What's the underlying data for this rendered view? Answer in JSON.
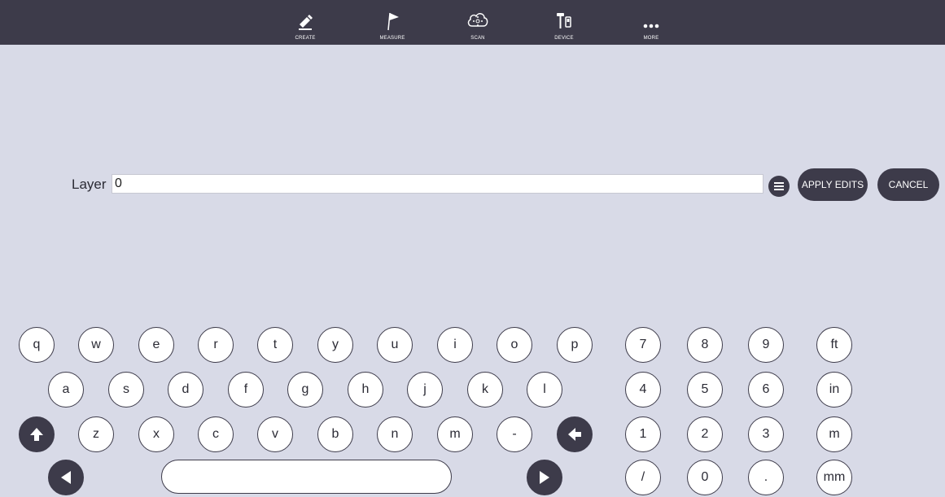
{
  "toolbar": {
    "items": [
      {
        "label": "CREATE",
        "icon": "pencil-icon"
      },
      {
        "label": "MEASURE",
        "icon": "flag-icon"
      },
      {
        "label": "SCAN",
        "icon": "scan-cloud-icon"
      },
      {
        "label": "DEVICE",
        "icon": "device-icon"
      },
      {
        "label": "MORE",
        "icon": "more-dots-icon"
      }
    ]
  },
  "form": {
    "layer_label": "Layer",
    "layer_value": "0",
    "menu_icon": "list-icon",
    "apply_label": "APPLY EDITS",
    "cancel_label": "CANCEL"
  },
  "keyboard": {
    "row1": [
      "q",
      "w",
      "e",
      "r",
      "t",
      "y",
      "u",
      "i",
      "o",
      "p"
    ],
    "row2": [
      "a",
      "s",
      "d",
      "f",
      "g",
      "h",
      "j",
      "k",
      "l"
    ],
    "row3": [
      "z",
      "x",
      "c",
      "v",
      "b",
      "n",
      "m",
      "-"
    ],
    "numpad": {
      "row1": [
        "7",
        "8",
        "9"
      ],
      "row2": [
        "4",
        "5",
        "6"
      ],
      "row3": [
        "1",
        "2",
        "3"
      ],
      "row4": [
        "/",
        "0",
        "."
      ]
    },
    "units": [
      "ft",
      "in",
      "m",
      "mm"
    ],
    "shift_icon": "arrow-up-icon",
    "backspace_icon": "arrow-left-icon",
    "cursor_left_icon": "triangle-left-icon",
    "cursor_right_icon": "triangle-right-icon",
    "colors": {
      "dark": "#3d3b4a",
      "background": "#d8dae7",
      "key_fill": "#ffffff"
    }
  }
}
